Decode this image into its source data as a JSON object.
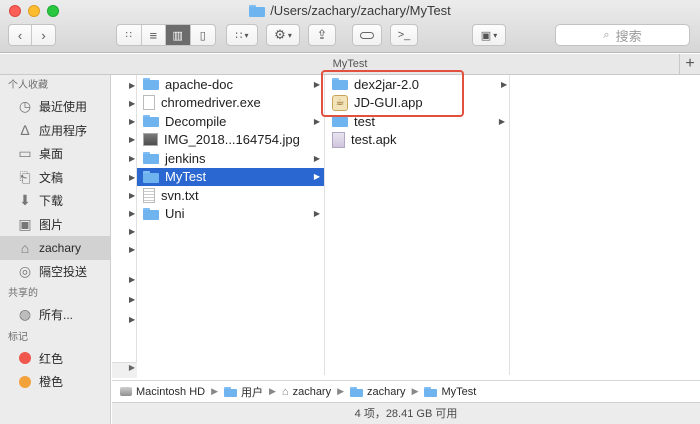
{
  "window": {
    "title": "/Users/zachary/zachary/MyTest",
    "path_title": "MyTest"
  },
  "toolbar": {
    "back_icon": "chevron-left-icon",
    "forward_icon": "chevron-right-icon",
    "search_placeholder": "搜索"
  },
  "sidebar": {
    "favorites_header": "个人收藏",
    "favorites": [
      {
        "label": "最近使用",
        "icon": "clock-icon"
      },
      {
        "label": "应用程序",
        "icon": "apps-icon"
      },
      {
        "label": "桌面",
        "icon": "desktop-icon"
      },
      {
        "label": "文稿",
        "icon": "document-icon"
      },
      {
        "label": "下载",
        "icon": "download-icon"
      },
      {
        "label": "图片",
        "icon": "camera-icon"
      },
      {
        "label": "zachary",
        "icon": "home-icon"
      },
      {
        "label": "隔空投送",
        "icon": "airdrop-icon"
      }
    ],
    "shared_header": "共享的",
    "shared": [
      {
        "label": "所有...",
        "icon": "network-icon"
      }
    ],
    "tags_header": "标记",
    "tags": [
      {
        "label": "红色",
        "color": "#f0574d"
      },
      {
        "label": "橙色",
        "color": "#f2a13b"
      }
    ]
  },
  "columns": {
    "col2": [
      {
        "name": "apache-doc",
        "type": "folder",
        "has_children": true
      },
      {
        "name": "chromedriver.exe",
        "type": "file",
        "has_children": false
      },
      {
        "name": "Decompile",
        "type": "folder",
        "has_children": true
      },
      {
        "name": "IMG_2018...164754.jpg",
        "type": "image",
        "has_children": false
      },
      {
        "name": "jenkins",
        "type": "folder",
        "has_children": true
      },
      {
        "name": "MyTest",
        "type": "folder",
        "has_children": true,
        "selected": true
      },
      {
        "name": "svn.txt",
        "type": "text",
        "has_children": false
      },
      {
        "name": "Uni",
        "type": "folder",
        "has_children": true
      }
    ],
    "col3": [
      {
        "name": "dex2jar-2.0",
        "type": "folder",
        "has_children": true
      },
      {
        "name": "JD-GUI.app",
        "type": "app",
        "has_children": false
      },
      {
        "name": "test",
        "type": "folder",
        "has_children": true
      },
      {
        "name": "test.apk",
        "type": "apk",
        "has_children": false
      }
    ]
  },
  "breadcrumb": {
    "items": [
      "Macintosh HD",
      "用户",
      "zachary",
      "zachary",
      "MyTest"
    ]
  },
  "status": {
    "text": "4 项，28.41 GB 可用"
  },
  "colors": {
    "selection": "#2a67d0",
    "highlight_box": "#e2503e"
  }
}
